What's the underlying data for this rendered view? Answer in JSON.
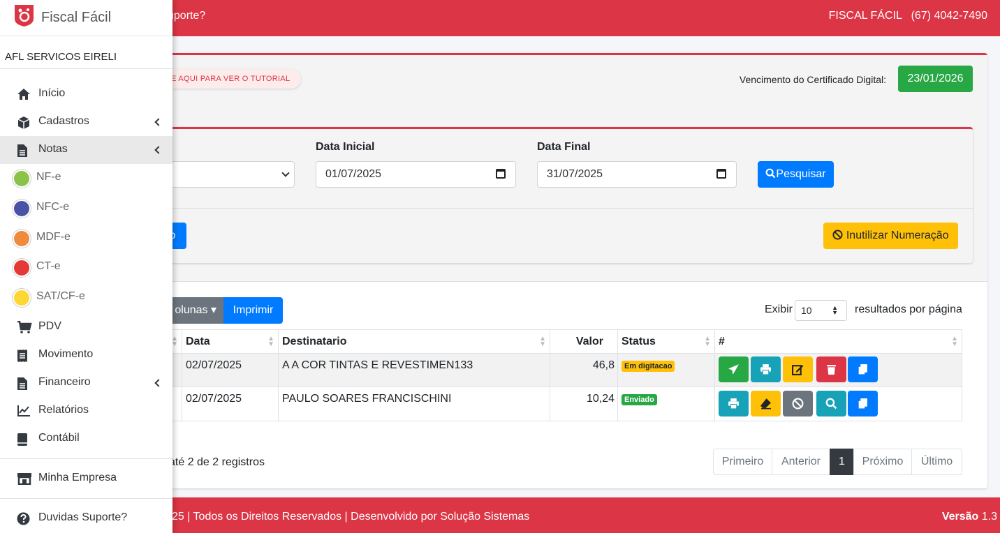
{
  "topbar": {
    "left_text": "uporte?",
    "right_text": "FISCAL FÁCIL   (67) 4042-7490"
  },
  "sidebar": {
    "brand": "Fiscal Fácil",
    "company": "AFL SERVICOS EIRELI",
    "items": [
      {
        "label": "Início",
        "icon": "home-icon"
      },
      {
        "label": "Cadastros",
        "icon": "cube-icon"
      },
      {
        "label": "Notas",
        "icon": "file-icon"
      },
      {
        "label": "NF-e"
      },
      {
        "label": "NFC-e"
      },
      {
        "label": "MDF-e"
      },
      {
        "label": "CT-e"
      },
      {
        "label": "SAT/CF-e"
      },
      {
        "label": "PDV",
        "icon": "cart-icon"
      },
      {
        "label": "Movimento",
        "icon": "receipt-icon"
      },
      {
        "label": "Financeiro",
        "icon": "file-icon"
      },
      {
        "label": "Relatórios",
        "icon": "chart-icon"
      },
      {
        "label": "Contábil",
        "icon": "book-icon"
      },
      {
        "label": "Minha Empresa",
        "icon": "store-icon"
      },
      {
        "label": "Duvidas Suporte?",
        "icon": "question-icon"
      }
    ],
    "sub_colors": [
      "#8bc34a",
      "#4a52a8",
      "#f08a3c",
      "#e53935",
      "#fdd835"
    ]
  },
  "header": {
    "tutorial": "E AQUI PARA VER O TUTORIAL",
    "cert_label": "Vencimento do Certificado Digital:",
    "cert_date": "23/01/2026"
  },
  "filter": {
    "start_label": "Data Inicial",
    "start_value": "01/07/2025",
    "end_label": "Data Final",
    "end_value": "31/07/2025",
    "search_label": "Pesquisar",
    "new_label": "o",
    "inutilizar_label": "Inutilizar Numeração"
  },
  "toolbar": {
    "columns_label": "olunas",
    "print_label": "Imprimir",
    "show_label": "Exibir",
    "page_size": "10",
    "per_page_label": "resultados por página"
  },
  "table": {
    "headers": [
      "Data",
      "Destinatario",
      "Valor",
      "Status",
      "#"
    ],
    "rows": [
      {
        "data": "02/07/2025",
        "destinatario": "A A COR TINTAS E REVESTIMEN133",
        "valor": "46,8",
        "status": "Em digitacao"
      },
      {
        "data": "02/07/2025",
        "destinatario": "PAULO SOARES FRANCISCHINI",
        "valor": "10,24",
        "status": "Enviado"
      }
    ]
  },
  "info": "até 2 de 2 registros",
  "pagination": {
    "first": "Primeiro",
    "prev": "Anterior",
    "current": "1",
    "next": "Próximo",
    "last": "Último"
  },
  "footer": {
    "left": "25 | Todos os Direitos Reservados | Desenvolvido por Solução Sistemas",
    "version_label": "Versão",
    "version": "1.3"
  }
}
